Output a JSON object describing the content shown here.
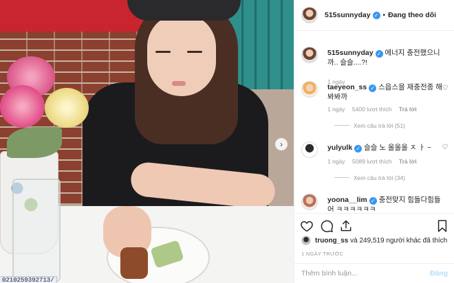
{
  "post": {
    "url_status": "0210259392713/"
  },
  "header": {
    "username": "515sunnyday",
    "separator": "•",
    "follow_status": "Đang theo dõi"
  },
  "caption": {
    "username": "515sunnyday",
    "text": "에너지 충전했으니까.. 슬슬....?!",
    "time": "1 ngày"
  },
  "comments": [
    {
      "username": "taeyeon_ss",
      "text": "스읍스을 재충전종 해봐봐까",
      "time": "1 ngày",
      "likes": "5400 lượt thích",
      "reply": "Trả lời",
      "view_replies": "Xem câu trả lời (51)",
      "verified": true
    },
    {
      "username": "yulyulk",
      "text": "슬슬 노 올올올 ㅈ ㅏ ~",
      "time": "1 ngày",
      "likes": "5089 lượt thích",
      "reply": "Trả lời",
      "view_replies": "Xem câu trả lời (34)",
      "verified": true
    },
    {
      "username": "yoona__lim",
      "text": "충전맞지 힘들다힘들어 ㅋㅋㅋㅋㅋㅋ",
      "verified": true
    }
  ],
  "likes": {
    "username": "truong_ss",
    "rest": "và 249,519 người khác đã thích"
  },
  "time_ago": "1 NGÀY TRƯỚC",
  "add_comment": {
    "placeholder": "Thêm bình luận...",
    "post_label": "Đăng"
  },
  "icons": {
    "heart": "heart-icon",
    "comment": "comment-icon",
    "share": "share-icon",
    "save": "bookmark-icon",
    "verified": "verified-badge-icon",
    "next": "chevron-right-icon"
  },
  "colors": {
    "verified": "#3897f0",
    "post_disabled": "#b2dffc",
    "muted": "#999999"
  }
}
